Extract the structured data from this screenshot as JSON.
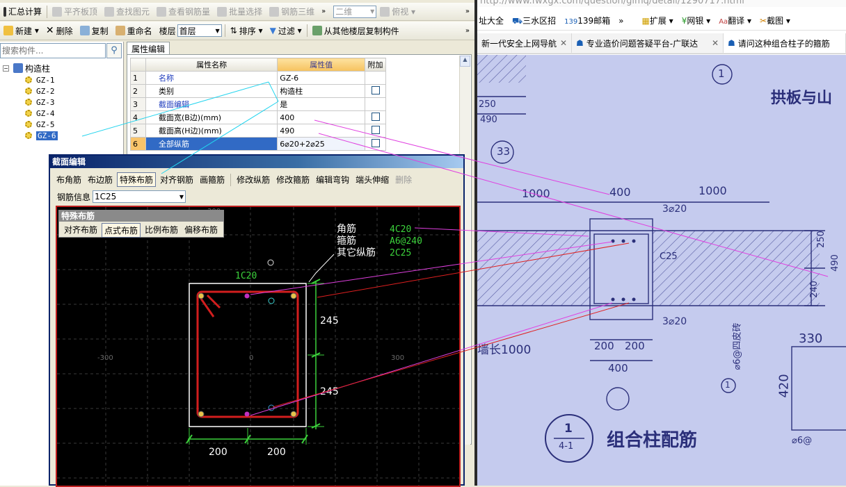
{
  "toolbar1": {
    "items": [
      "汇总计算",
      "平齐板顶",
      "查找图元",
      "查看钢筋量",
      "批量选择",
      "钢筋三维"
    ],
    "view_mode": "二维",
    "view_label": "俯视"
  },
  "toolbar2": {
    "new": "新建",
    "delete": "删除",
    "copy": "复制",
    "rename": "重命名",
    "floor_label": "楼层",
    "floor_value": "首层",
    "sort": "排序",
    "filter": "过滤",
    "copy_from_floor": "从其他楼层复制构件"
  },
  "search": {
    "placeholder": "搜索构件..."
  },
  "tree": {
    "root": "构造柱",
    "items": [
      "GZ-1",
      "GZ-2",
      "GZ-3",
      "GZ-4",
      "GZ-5",
      "GZ-6"
    ],
    "selected": "GZ-6"
  },
  "props": {
    "tab": "属性编辑",
    "headers": [
      "属性名称",
      "属性值",
      "附加"
    ],
    "rows": [
      {
        "n": "1",
        "name": "名称",
        "value": "GZ-6"
      },
      {
        "n": "2",
        "name": "类别",
        "value": "构造柱"
      },
      {
        "n": "3",
        "name": "截面编辑",
        "value": "是"
      },
      {
        "n": "4",
        "name": "截面宽(B边)(mm)",
        "value": "400"
      },
      {
        "n": "5",
        "name": "截面高(H边)(mm)",
        "value": "490"
      },
      {
        "n": "6",
        "name": "全部纵筋",
        "value": "6⌀20+2⌀25"
      }
    ]
  },
  "section_dialog": {
    "title": "截面编辑",
    "buttons": [
      "布角筋",
      "布边筋",
      "特殊布筋",
      "对齐钢筋",
      "画箍筋",
      "修改纵筋",
      "修改箍筋",
      "编辑弯钩",
      "端头伸缩",
      "删除"
    ],
    "rebar_label": "钢筋信息",
    "rebar_value": "1C25",
    "special_panel": {
      "title": "特殊布筋",
      "buttons": [
        "对齐布筋",
        "点式布筋",
        "比例布筋",
        "偏移布筋"
      ]
    },
    "canvas": {
      "legend_labels": [
        "角筋",
        "箍筋",
        "其它纵筋"
      ],
      "legend_values": [
        "4C20",
        "A6@240",
        "2C25"
      ],
      "top_rebar": "1C20",
      "dim_right_top": "245",
      "dim_right_bottom": "245",
      "dim_bottom_left": "200",
      "dim_bottom_right": "200",
      "grid_labels": [
        "300",
        "-300",
        "0",
        "300"
      ]
    }
  },
  "browser": {
    "url": "http://www.fwxgx.com/question/gimq/detail/1290717.html",
    "bookmarks": [
      "址大全",
      "三水区招",
      "139邮箱",
      "扩展",
      "网银",
      "翻译",
      "截图"
    ],
    "tabs": [
      "新一代安全上网导航",
      "专业造价问题答疑平台-广联达",
      "请问这种组合柱子的箍筋"
    ]
  },
  "photo": {
    "texts": [
      "拱板与山",
      "1000",
      "400",
      "1000",
      "3⌀20",
      "C25",
      "250",
      "240",
      "490",
      "3⌀20",
      "200",
      "200",
      "400",
      "330",
      "420",
      "组合柱配筋",
      "⌀6@四皮砖",
      "墙长1000",
      "⌀6@",
      "250",
      "490",
      "33",
      "1",
      "1",
      "4-1",
      "1"
    ]
  },
  "colors": {
    "canvas_bg": "#000000",
    "accent_red": "#d21e1e",
    "accent_green": "#3cd23c",
    "selection_blue": "#316ac5"
  }
}
